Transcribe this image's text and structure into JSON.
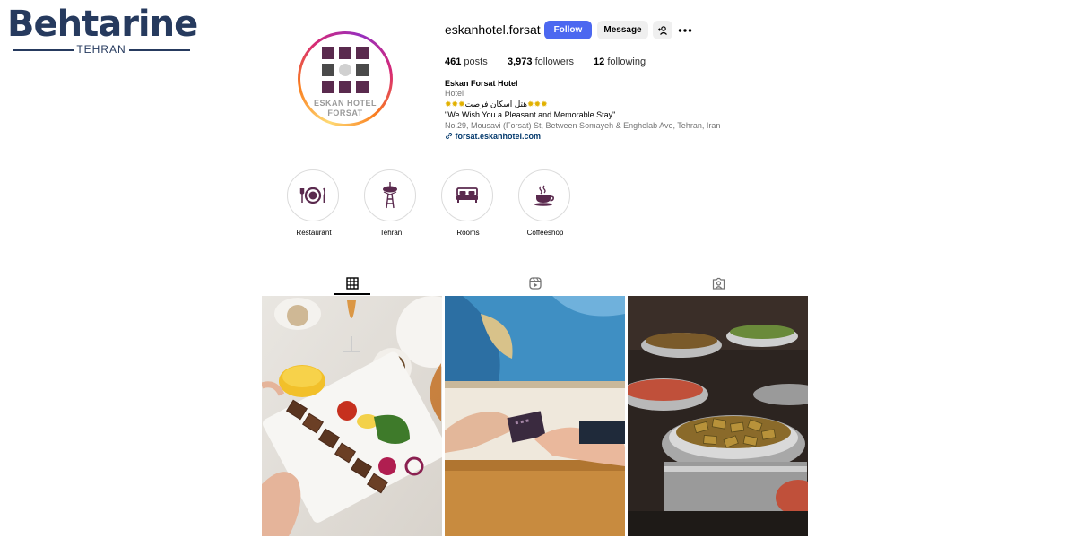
{
  "brand": {
    "title": "Behtarine",
    "subtitle": "TEHRAN"
  },
  "profile": {
    "username": "eskanhotel.forsat",
    "avatar_text_line1": "ESKAN HOTEL",
    "avatar_text_line2": "FORSAT",
    "follow_label": "Follow",
    "message_label": "Message",
    "add_user_icon": "add-user-icon",
    "more_icon": "more-options-icon"
  },
  "stats": {
    "posts_count": "461",
    "posts_label": "posts",
    "followers_count": "3,973",
    "followers_label": "followers",
    "following_count": "12",
    "following_label": "following"
  },
  "bio": {
    "name": "Eskan Forsat Hotel",
    "category": "Hotel",
    "line1": "هتل اسکان فرصت",
    "line2": "\"We Wish You a Pleasant and Memorable Stay\"",
    "address": "No.29, Mousavi (Forsat) St, Between Somayeh & Enghelab Ave, Tehran, Iran",
    "link": "forsat.eskanhotel.com"
  },
  "highlights": [
    {
      "label": "Restaurant",
      "icon": "plate-cutlery-icon"
    },
    {
      "label": "Tehran",
      "icon": "milad-tower-icon"
    },
    {
      "label": "Rooms",
      "icon": "bed-icon"
    },
    {
      "label": "Coffeeshop",
      "icon": "coffee-cup-icon"
    }
  ],
  "tabs": [
    {
      "name": "posts",
      "icon": "grid-icon",
      "active": true
    },
    {
      "name": "reels",
      "icon": "reels-icon",
      "active": false
    },
    {
      "name": "tagged",
      "icon": "tagged-icon",
      "active": false
    }
  ],
  "posts": [
    {
      "subject": "kebab-plate-photo"
    },
    {
      "subject": "key-card-handover-photo"
    },
    {
      "subject": "buffet-photo"
    }
  ],
  "colors": {
    "follow_button": "#4c68f0",
    "highlight_icon": "#5a2a4e",
    "brand": "#263a5e"
  }
}
